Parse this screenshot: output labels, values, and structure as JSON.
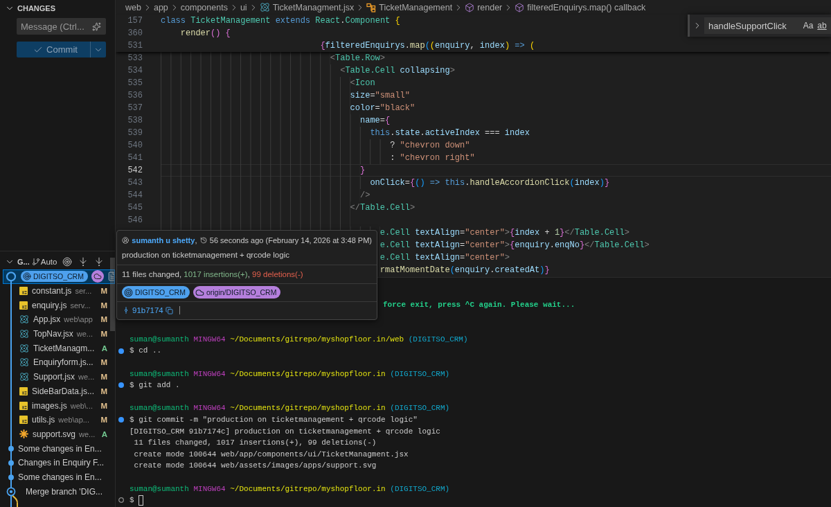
{
  "sidebar": {
    "changes": {
      "title": "CHANGES",
      "expanded": true,
      "message": {
        "placeholder": "Message (Ctrl..."
      },
      "commit": {
        "label": "Commit",
        "disabled": true
      }
    },
    "graph": {
      "title": "G...",
      "expanded": true,
      "ref_filter": "Auto",
      "rows": [
        {
          "kind": "head",
          "selected": true,
          "refs": [
            {
              "kind": "local",
              "text": "DIGITSO_CRM"
            },
            {
              "kind": "remote"
            }
          ],
          "files": [
            {
              "kind": "js",
              "name": "constant.js",
              "path": "ser...",
              "status": "M",
              "color": "#e2c08d"
            },
            {
              "kind": "js",
              "name": "enquiry.js",
              "path": "serv...",
              "status": "M",
              "color": "#e2c08d"
            },
            {
              "kind": "react",
              "name": "App.jsx",
              "path": "web\\app",
              "status": "M",
              "color": "#e2c08d"
            },
            {
              "kind": "react",
              "name": "TopNav.jsx",
              "path": "we...",
              "status": "M",
              "color": "#e2c08d"
            },
            {
              "kind": "react",
              "name": "TicketManagm...",
              "status": "A",
              "color": "#73c991"
            },
            {
              "kind": "react",
              "name": "Enquiryform.js...",
              "status": "M",
              "color": "#e2c08d"
            },
            {
              "kind": "react",
              "name": "Support.jsx",
              "path": "we...",
              "status": "M",
              "color": "#e2c08d"
            },
            {
              "kind": "js",
              "name": "SideBarData.js...",
              "status": "M",
              "color": "#e2c08d"
            },
            {
              "kind": "js",
              "name": "images.js",
              "path": "web\\...",
              "status": "M",
              "color": "#e2c08d"
            },
            {
              "kind": "js",
              "name": "utils.js",
              "path": "web\\ap...",
              "status": "M",
              "color": "#e2c08d"
            },
            {
              "kind": "image",
              "name": "support.svg",
              "path": "we...",
              "status": "A",
              "color": "#73c991"
            }
          ]
        },
        {
          "kind": "commit",
          "selected": false,
          "message": "Some changes in En..."
        },
        {
          "kind": "commit",
          "selected": false,
          "message": "Changes in Enquiry F..."
        },
        {
          "kind": "commit",
          "selected": false,
          "message": "Some changes in En..."
        },
        {
          "kind": "merge",
          "selected": false,
          "message": "Merge branch 'DIG..."
        }
      ]
    }
  },
  "editor": {
    "breadcrumbs": [
      {
        "kind": "folder",
        "text": "web"
      },
      {
        "kind": "folder",
        "text": "app"
      },
      {
        "kind": "folder",
        "text": "components"
      },
      {
        "kind": "folder",
        "text": "ui"
      },
      {
        "kind": "react-file",
        "text": "TicketManagment.jsx"
      },
      {
        "kind": "class",
        "text": "TicketManagement"
      },
      {
        "kind": "method",
        "text": "render"
      },
      {
        "kind": "method",
        "text": "filteredEnquirys.map() callback"
      }
    ],
    "find": {
      "value": "handleSupportClick",
      "options": [
        {
          "kind": "match-case",
          "text": "Aa"
        },
        {
          "kind": "whole-word",
          "text": "ab"
        }
      ]
    },
    "sticky_lines": [
      {
        "number": "157",
        "tokens": [
          {
            "kind": "kw",
            "text": "class "
          },
          {
            "kind": "type",
            "text": "TicketManagement "
          },
          {
            "kind": "kw",
            "text": "extends "
          },
          {
            "kind": "type",
            "text": "React"
          },
          {
            "kind": "plain",
            "text": "."
          },
          {
            "kind": "type",
            "text": "Component "
          },
          {
            "kind": "gold",
            "text": "{"
          }
        ]
      },
      {
        "number": "360",
        "tokens": [
          {
            "kind": "fn",
            "text": "    render"
          },
          {
            "kind": "pink",
            "text": "() {"
          }
        ]
      },
      {
        "number": "531",
        "tokens": [
          {
            "kind": "pink",
            "text": "                                {"
          },
          {
            "kind": "var",
            "text": "filteredEnquirys"
          },
          {
            "kind": "plain",
            "text": "."
          },
          {
            "kind": "fn",
            "text": "map"
          },
          {
            "kind": "blue",
            "text": "("
          },
          {
            "kind": "gold",
            "text": "("
          },
          {
            "kind": "var",
            "text": "enquiry"
          },
          {
            "kind": "plain",
            "text": ", "
          },
          {
            "kind": "var",
            "text": "index"
          },
          {
            "kind": "gold",
            "text": ") "
          },
          {
            "kind": "kw",
            "text": "=> "
          },
          {
            "kind": "gold",
            "text": "("
          }
        ]
      }
    ],
    "lines": [
      {
        "number": "533",
        "current": false,
        "tokens": [
          {
            "kind": "tag",
            "text": "                                  <"
          },
          {
            "kind": "type",
            "text": "Table.Row"
          },
          {
            "kind": "tag",
            "text": ">"
          }
        ]
      },
      {
        "number": "534",
        "current": false,
        "tokens": [
          {
            "kind": "tag",
            "text": "                                    <"
          },
          {
            "kind": "type",
            "text": "Table.Cell "
          },
          {
            "kind": "attr",
            "text": "collapsing"
          },
          {
            "kind": "tag",
            "text": ">"
          }
        ]
      },
      {
        "number": "535",
        "current": false,
        "tokens": [
          {
            "kind": "tag",
            "text": "                                      <"
          },
          {
            "kind": "type",
            "text": "Icon"
          }
        ]
      },
      {
        "number": "536",
        "current": false,
        "tokens": [
          {
            "kind": "attr",
            "text": "                                      size"
          },
          {
            "kind": "plain",
            "text": "="
          },
          {
            "kind": "str",
            "text": "\"small\""
          }
        ]
      },
      {
        "number": "537",
        "current": false,
        "tokens": [
          {
            "kind": "attr",
            "text": "                                      color"
          },
          {
            "kind": "plain",
            "text": "="
          },
          {
            "kind": "str",
            "text": "\"black\""
          }
        ]
      },
      {
        "number": "538",
        "current": false,
        "tokens": [
          {
            "kind": "attr",
            "text": "                                        name"
          },
          {
            "kind": "plain",
            "text": "="
          },
          {
            "kind": "pink",
            "text": "{"
          }
        ]
      },
      {
        "number": "539",
        "current": false,
        "tokens": [
          {
            "kind": "kw",
            "text": "                                          this"
          },
          {
            "kind": "plain",
            "text": "."
          },
          {
            "kind": "var",
            "text": "state"
          },
          {
            "kind": "plain",
            "text": "."
          },
          {
            "kind": "var",
            "text": "activeIndex"
          },
          {
            "kind": "plain",
            "text": " === "
          },
          {
            "kind": "var",
            "text": "index"
          }
        ]
      },
      {
        "number": "540",
        "current": false,
        "tokens": [
          {
            "kind": "plain",
            "text": "                                              ? "
          },
          {
            "kind": "str",
            "text": "\"chevron down\""
          }
        ]
      },
      {
        "number": "541",
        "current": false,
        "tokens": [
          {
            "kind": "plain",
            "text": "                                              : "
          },
          {
            "kind": "str",
            "text": "\"chevron right\""
          }
        ]
      },
      {
        "number": "542",
        "current": true,
        "tokens": [
          {
            "kind": "pink",
            "text": "                                        }"
          }
        ]
      },
      {
        "number": "543",
        "current": false,
        "tokens": [
          {
            "kind": "attr",
            "text": "                                          onClick"
          },
          {
            "kind": "plain",
            "text": "="
          },
          {
            "kind": "pink",
            "text": "{"
          },
          {
            "kind": "blue",
            "text": "() "
          },
          {
            "kind": "kw",
            "text": "=> "
          },
          {
            "kind": "kw",
            "text": "this"
          },
          {
            "kind": "plain",
            "text": "."
          },
          {
            "kind": "fn",
            "text": "handleAccordionClick"
          },
          {
            "kind": "blue",
            "text": "("
          },
          {
            "kind": "var",
            "text": "index"
          },
          {
            "kind": "blue",
            "text": ")"
          },
          {
            "kind": "pink",
            "text": "}"
          }
        ]
      },
      {
        "number": "544",
        "current": false,
        "tokens": [
          {
            "kind": "tag",
            "text": "                                        />"
          }
        ]
      },
      {
        "number": "545",
        "current": false,
        "tokens": [
          {
            "kind": "tag",
            "text": "                                      </"
          },
          {
            "kind": "type",
            "text": "Table.Cell"
          },
          {
            "kind": "tag",
            "text": ">"
          }
        ]
      },
      {
        "number": "546",
        "current": false
      },
      {
        "current": false,
        "tokens": [
          {
            "kind": "type",
            "text": "                                            e.Cell "
          },
          {
            "kind": "attr",
            "text": "textAlign"
          },
          {
            "kind": "plain",
            "text": "="
          },
          {
            "kind": "str",
            "text": "\"center\""
          },
          {
            "kind": "tag",
            "text": ">"
          },
          {
            "kind": "pink",
            "text": "{"
          },
          {
            "kind": "var",
            "text": "index"
          },
          {
            "kind": "plain",
            "text": " + "
          },
          {
            "kind": "num",
            "text": "1"
          },
          {
            "kind": "pink",
            "text": "}"
          },
          {
            "kind": "tag",
            "text": "</"
          },
          {
            "kind": "type",
            "text": "Table.Cell"
          },
          {
            "kind": "tag",
            "text": ">"
          }
        ]
      },
      {
        "current": false,
        "tokens": [
          {
            "kind": "type",
            "text": "                                            e.Cell "
          },
          {
            "kind": "attr",
            "text": "textAlign"
          },
          {
            "kind": "plain",
            "text": "="
          },
          {
            "kind": "str",
            "text": "\"center\""
          },
          {
            "kind": "tag",
            "text": ">"
          },
          {
            "kind": "pink",
            "text": "{"
          },
          {
            "kind": "var",
            "text": "enquiry"
          },
          {
            "kind": "plain",
            "text": "."
          },
          {
            "kind": "var",
            "text": "enqNo"
          },
          {
            "kind": "pink",
            "text": "}"
          },
          {
            "kind": "tag",
            "text": "</"
          },
          {
            "kind": "type",
            "text": "Table.Cell"
          },
          {
            "kind": "tag",
            "text": ">"
          }
        ]
      },
      {
        "current": false,
        "tokens": [
          {
            "kind": "type",
            "text": "                                            e.Cell "
          },
          {
            "kind": "attr",
            "text": "textAlign"
          },
          {
            "kind": "plain",
            "text": "="
          },
          {
            "kind": "str",
            "text": "\"center\""
          },
          {
            "kind": "tag",
            "text": ">"
          }
        ]
      },
      {
        "current": false,
        "tokens": [
          {
            "kind": "fn",
            "text": "                                            rmatMomentDate"
          },
          {
            "kind": "blue",
            "text": "("
          },
          {
            "kind": "var",
            "text": "enquiry"
          },
          {
            "kind": "plain",
            "text": "."
          },
          {
            "kind": "var",
            "text": "createdAt"
          },
          {
            "kind": "blue",
            "text": ")"
          },
          {
            "kind": "pink",
            "text": "}"
          }
        ]
      }
    ]
  },
  "hover": {
    "author": "sumanth u shetty",
    "comma": ",",
    "time": "56 seconds ago (February 14, 2026 at 3:48 PM)",
    "message": "production on ticketmanagement + qrcode logic",
    "stats": [
      {
        "kind": "plain",
        "text": "11 files changed, "
      },
      {
        "kind": "insertions",
        "text": "1017 insertions(+)"
      },
      {
        "kind": "plain",
        "text": ", "
      },
      {
        "kind": "deletions",
        "text": "99 deletions(-)"
      }
    ],
    "refs": [
      {
        "kind": "local",
        "text": "DIGITSO_CRM"
      },
      {
        "kind": "remote",
        "text": "origin/DIGITSO_CRM"
      }
    ],
    "hash": "91b7174"
  },
  "terminal": {
    "notice": "force exit, press ^C again. Please wait...",
    "blocks": [
      {
        "kind": "success",
        "user": "suman@sumanth",
        "system": "MINGW64",
        "path": "~/Documents/gitrepo/myshopfloor.in/web",
        "branch": "(DIGITSO_CRM)",
        "command": "$ cd .."
      },
      {
        "kind": "success",
        "user": "suman@sumanth",
        "system": "MINGW64",
        "path": "~/Documents/gitrepo/myshopfloor.in",
        "branch": "(DIGITSO_CRM)",
        "command": "$ git add ."
      },
      {
        "kind": "success",
        "user": "suman@sumanth",
        "system": "MINGW64",
        "path": "~/Documents/gitrepo/myshopfloor.in",
        "branch": "(DIGITSO_CRM)",
        "command": "$ git commit -m \"production on ticketmanagement + qrcode logic\"",
        "output": [
          "[DIGITSO_CRM 91b7174c] production on ticketmanagement + qrcode logic",
          " 11 files changed, 1017 insertions(+), 99 deletions(-)",
          " create mode 100644 web/app/components/ui/TicketManagment.jsx",
          " create mode 100644 web/assets/images/apps/support.svg"
        ]
      },
      {
        "kind": "pending",
        "user": "suman@sumanth",
        "system": "MINGW64",
        "path": "~/Documents/gitrepo/myshopfloor.in",
        "branch": "(DIGITSO_CRM)",
        "command": "$",
        "cursor": true
      }
    ]
  }
}
